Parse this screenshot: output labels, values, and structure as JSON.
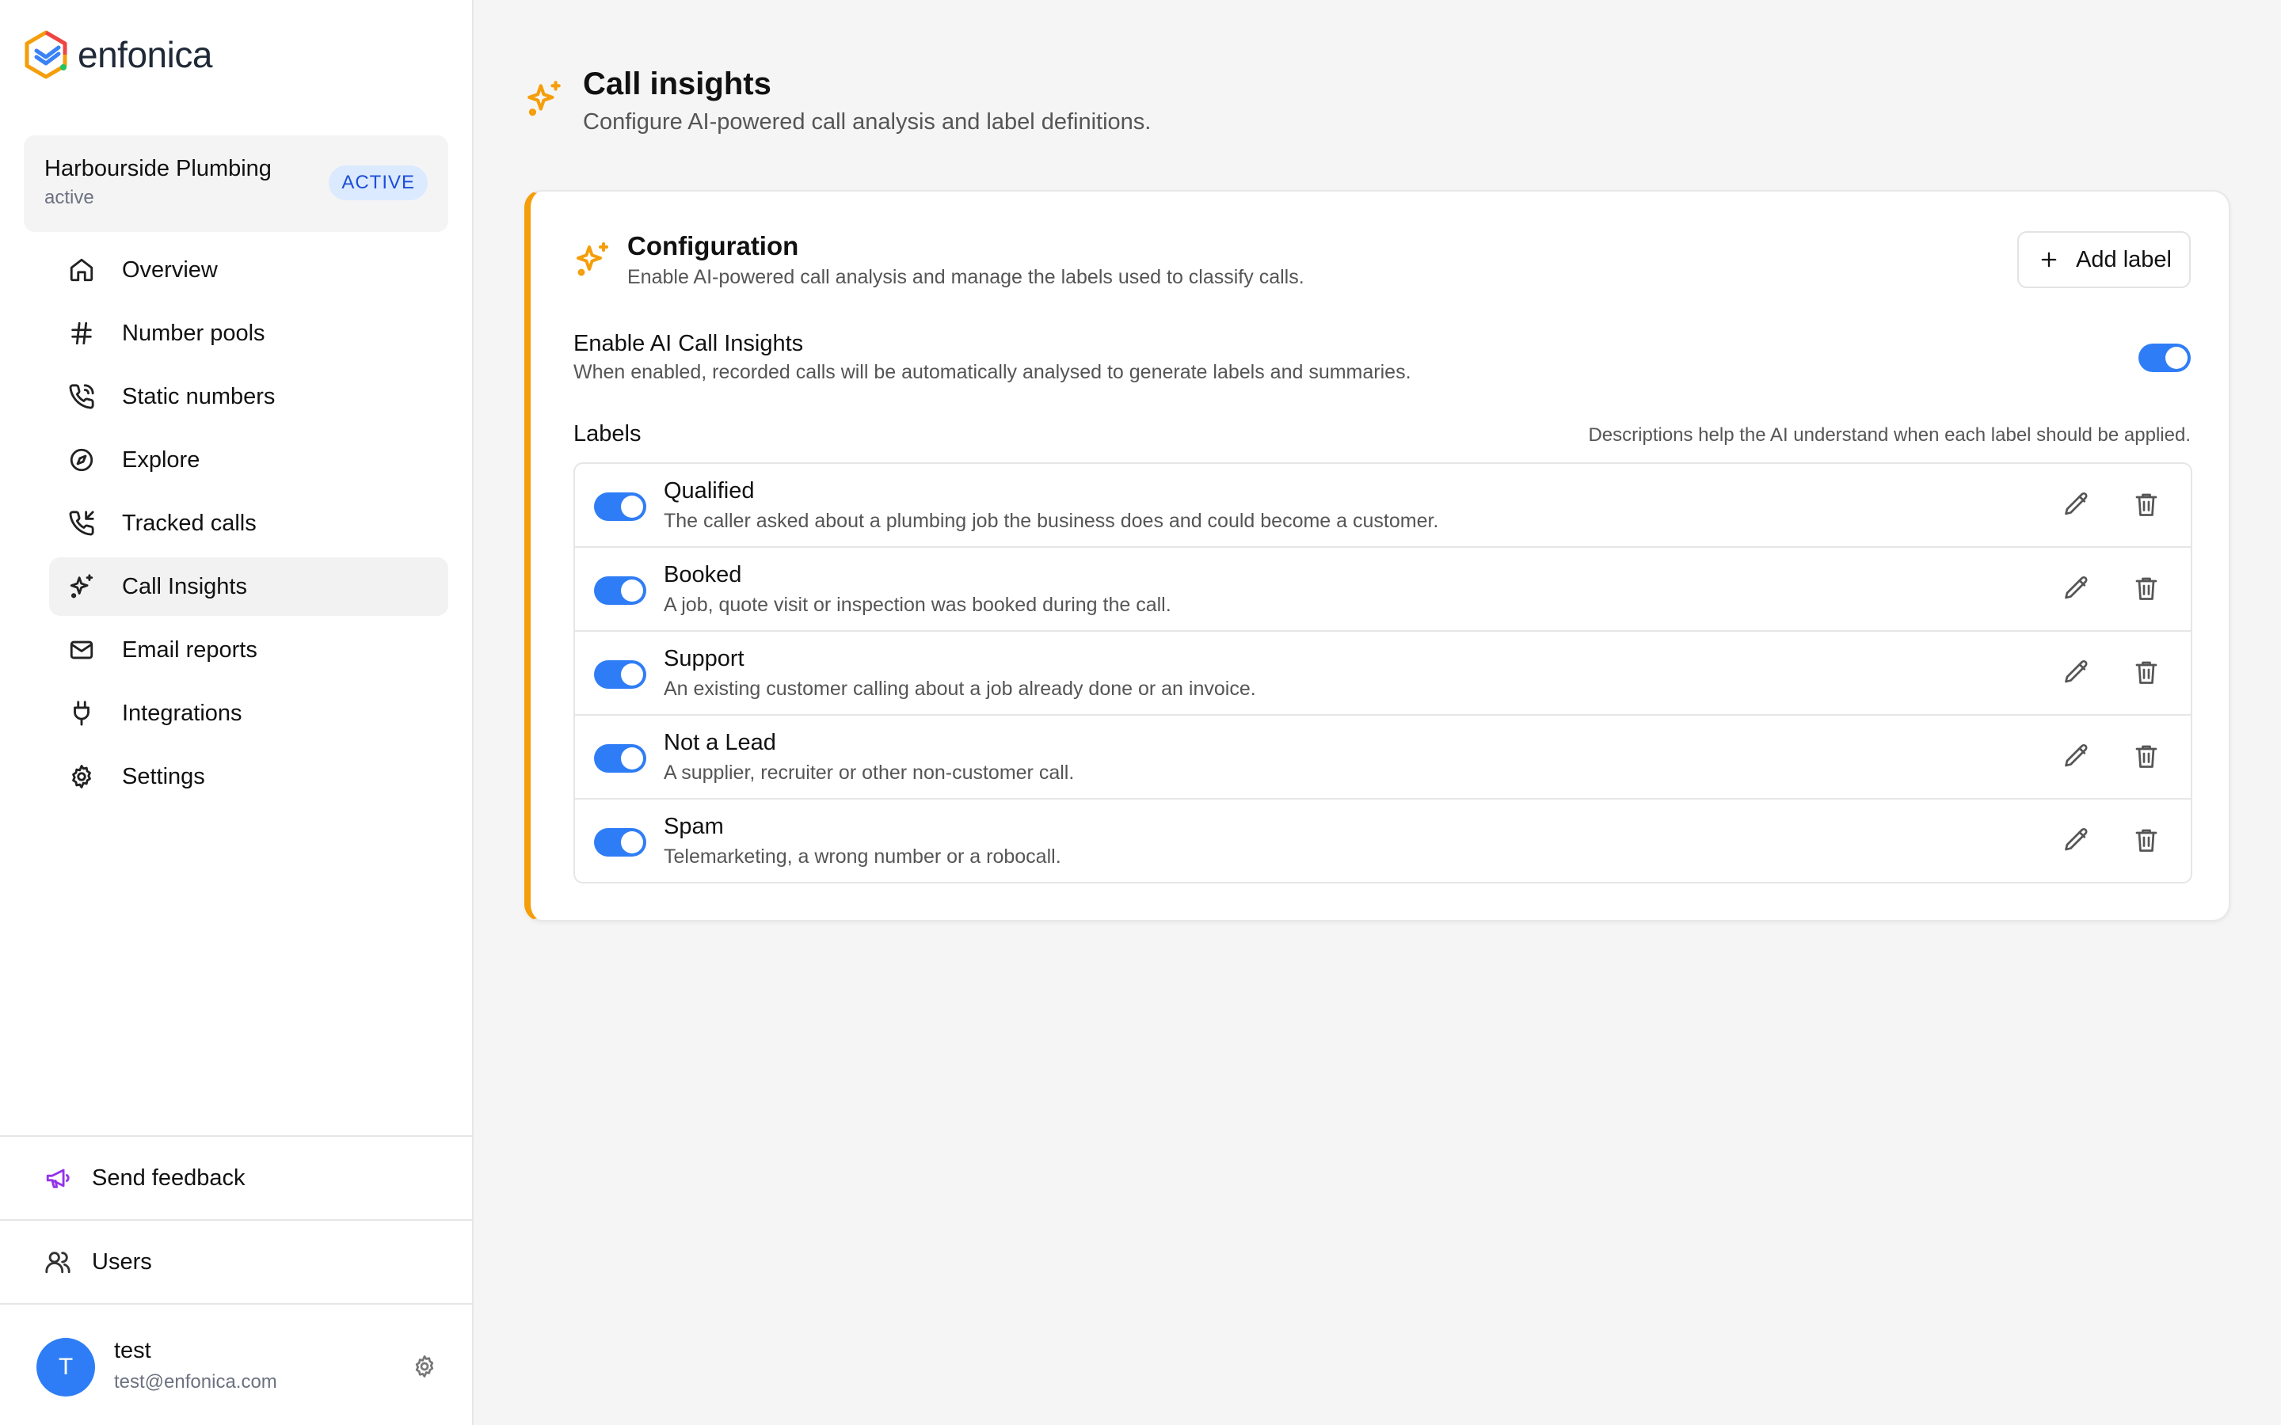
{
  "brand": {
    "name": "enfonica"
  },
  "workspace": {
    "name": "Harbourside Plumbing",
    "status": "active",
    "badge": "ACTIVE"
  },
  "nav": {
    "items": [
      {
        "label": "Overview",
        "icon": "home-icon"
      },
      {
        "label": "Number pools",
        "icon": "hash-icon"
      },
      {
        "label": "Static numbers",
        "icon": "phone-icon"
      },
      {
        "label": "Explore",
        "icon": "compass-icon"
      },
      {
        "label": "Tracked calls",
        "icon": "phone-incoming-icon"
      },
      {
        "label": "Call Insights",
        "icon": "sparkles-icon",
        "active": true
      },
      {
        "label": "Email reports",
        "icon": "mail-icon"
      },
      {
        "label": "Integrations",
        "icon": "plug-icon"
      },
      {
        "label": "Settings",
        "icon": "gear-icon"
      }
    ]
  },
  "footer": {
    "feedback": "Send feedback",
    "users": "Users"
  },
  "user": {
    "initial": "T",
    "name": "test",
    "email": "test@enfonica.com"
  },
  "page": {
    "title": "Call insights",
    "subtitle": "Configure AI-powered call analysis and label definitions."
  },
  "config": {
    "title": "Configuration",
    "description": "Enable AI-powered call analysis and manage the labels used to classify calls.",
    "add_label": "Add label",
    "enable_title": "Enable AI Call Insights",
    "enable_description": "When enabled, recorded calls will be automatically analysed to generate labels and summaries.",
    "enabled": true,
    "labels_title": "Labels",
    "labels_hint": "Descriptions help the AI understand when each label should be applied."
  },
  "labels": [
    {
      "name": "Qualified",
      "description": "The caller asked about a plumbing job the business does and could become a customer.",
      "enabled": true
    },
    {
      "name": "Booked",
      "description": "A job, quote visit or inspection was booked during the call.",
      "enabled": true
    },
    {
      "name": "Support",
      "description": "An existing customer calling about a job already done or an invoice.",
      "enabled": true
    },
    {
      "name": "Not a Lead",
      "description": "A supplier, recruiter or other non-customer call.",
      "enabled": true
    },
    {
      "name": "Spam",
      "description": "Telemarketing, a wrong number or a robocall.",
      "enabled": true
    }
  ],
  "colors": {
    "accent": "#f59e0b",
    "toggle": "#2f7df6",
    "badge_bg": "#dbeafe",
    "badge_text": "#1d4ed8",
    "feedback_icon": "#9333ea"
  }
}
